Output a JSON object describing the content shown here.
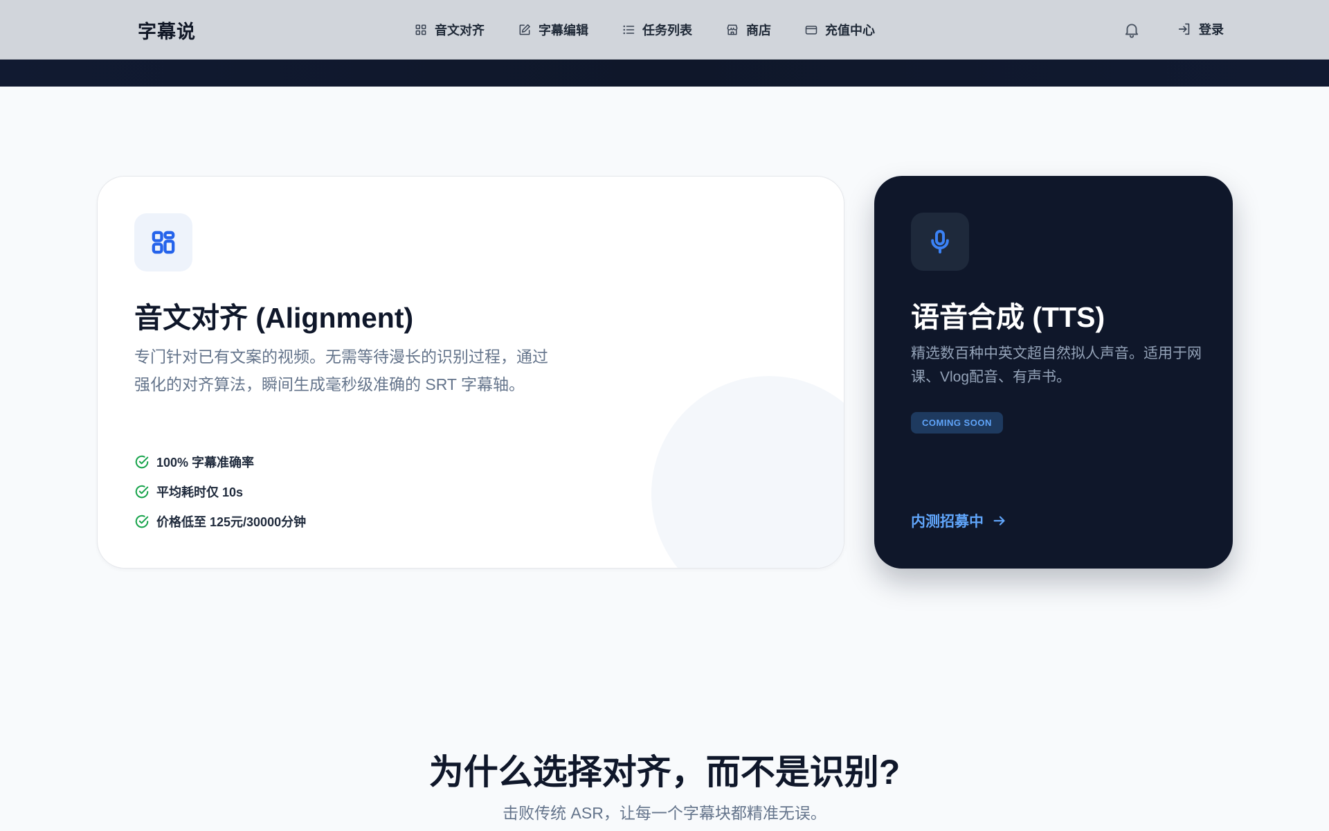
{
  "header": {
    "brand": "字幕说",
    "nav": [
      {
        "label": "音文对齐",
        "icon": "grid-icon"
      },
      {
        "label": "字幕编辑",
        "icon": "edit-icon"
      },
      {
        "label": "任务列表",
        "icon": "list-icon"
      },
      {
        "label": "商店",
        "icon": "store-icon"
      },
      {
        "label": "充值中心",
        "icon": "card-icon"
      }
    ],
    "notifications_icon": "bell-icon",
    "login_label": "登录"
  },
  "alignment_card": {
    "icon": "grid-icon",
    "title": "音文对齐 (Alignment)",
    "description": "专门针对已有文案的视频。无需等待漫长的识别过程，通过强化的对齐算法，瞬间生成毫秒级准确的 SRT 字幕轴。",
    "features": [
      "100% 字幕准确率",
      "平均耗时仅 10s",
      "价格低至 125元/30000分钟"
    ],
    "accent_color": "#2563eb",
    "check_color": "#16a34a"
  },
  "tts_card": {
    "icon": "microphone-icon",
    "title": "语音合成 (TTS)",
    "description": "精选数百种中英文超自然拟人声音。适用于网课、Vlog配音、有声书。",
    "badge": "COMING SOON",
    "link_label": "内测招募中",
    "background": "#0f172a",
    "accent_color": "#60a5fa"
  },
  "why_section": {
    "title": "为什么选择对齐，而不是识别?",
    "subtitle": "击败传统 ASR，让每一个字幕块都精准无误。"
  }
}
